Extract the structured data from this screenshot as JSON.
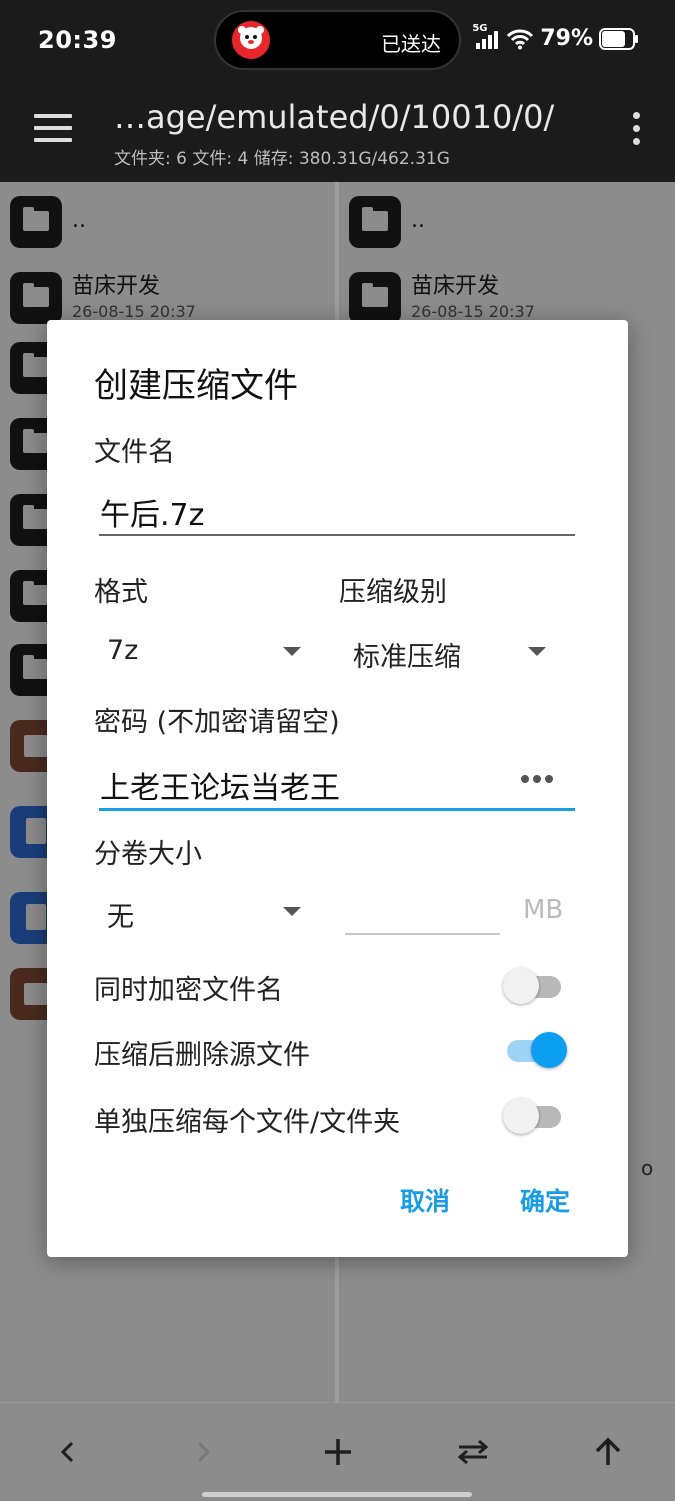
{
  "status_bar": {
    "time": "20:39",
    "notification_text": "已送达",
    "network_label": "5G",
    "battery_percent": "79%"
  },
  "app_bar": {
    "path": "…age/emulated/0/10010/0/",
    "info": "文件夹: 6  文件: 4  储存: 380.31G/462.31G"
  },
  "left_pane": {
    "items": [
      {
        "name": "..",
        "date": "",
        "icon": "folder-icon"
      },
      {
        "name": "苗床开发",
        "date": "26-08-15 20:37",
        "icon": "folder-icon"
      }
    ]
  },
  "right_pane": {
    "items": [
      {
        "name": "..",
        "date": "",
        "icon": "folder-icon"
      },
      {
        "name": "苗床开发",
        "date": "26-08-15 20:37",
        "icon": "folder-icon"
      }
    ],
    "peek_text": "o"
  },
  "dialog": {
    "title": "创建压缩文件",
    "filename_label": "文件名",
    "filename_value": "午后.7z",
    "format_label": "格式",
    "format_value": "7z",
    "level_label": "压缩级别",
    "level_value": "标准压缩",
    "password_label": "密码 (不加密请留空)",
    "password_value": "上老王论坛当老王",
    "volume_label": "分卷大小",
    "volume_value": "无",
    "volume_unit": "MB",
    "toggles": [
      {
        "label": "同时加密文件名",
        "on": false
      },
      {
        "label": "压缩后删除源文件",
        "on": true
      },
      {
        "label": "单独压缩每个文件/文件夹",
        "on": false
      }
    ],
    "cancel_label": "取消",
    "ok_label": "确定",
    "accent_color": "#1a9be6"
  },
  "bottom_bar": {
    "buttons": [
      "back-icon",
      "forward-icon",
      "add-icon",
      "swap-icon",
      "up-icon"
    ]
  }
}
